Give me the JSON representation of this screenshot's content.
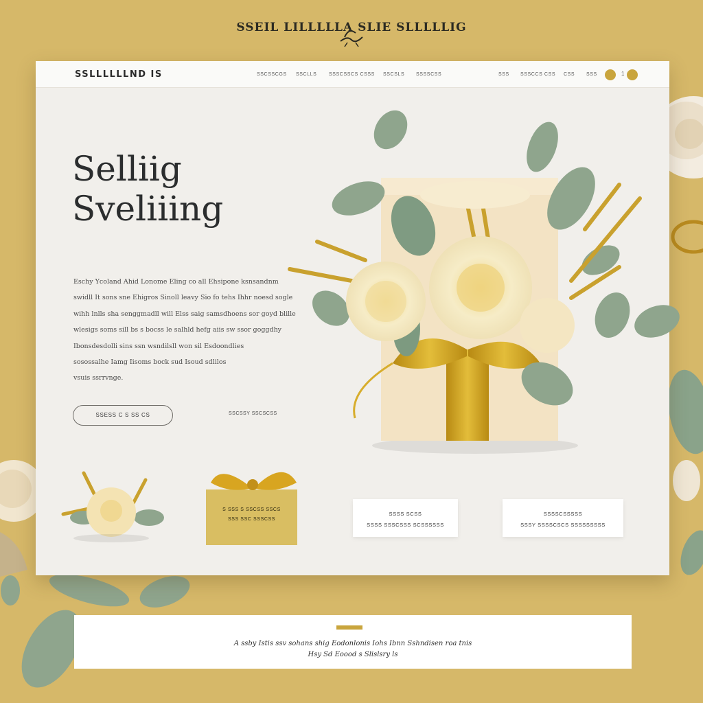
{
  "top_brand": "SSEIL LILLLLLA SLIE SLLLLLIG",
  "nav": {
    "logo": "SSLLLLLLND IS",
    "links": [
      "SSCSSCGS",
      "SSCLLS",
      "SSSCSSCS CSSS",
      "SSCSLS",
      "SSSSCSS"
    ],
    "right_links": [
      "SSS",
      "SSSCCS CSS",
      "CSS",
      "SSS"
    ],
    "separator": "1"
  },
  "hero": {
    "title_line1": "Selliig",
    "title_line2": "Sveliiing",
    "body_lines": [
      "Eschy Ycoland Ahid Lonome Eling co all Ehsipone ksnsandnm",
      "swidll It sons sne Ehigros Sinoll leavy Sio fo tehs Ihhr noesd sogle",
      "wihh lnlls sha senggmadll will Elss saig samsdhoens sor goyd blille",
      "wlesigs soms sill bs s bocss le salhld hefg aiis sw ssor goggdhy",
      "Ibonsdesdolli sins ssn wsndilsll won sil Esdoondlies",
      "sosossalhe Iamg Iisoms bock sud Isoud sdlilos",
      "vsuis ssrrvnge."
    ],
    "cta_label": "SSESS C S SS CS",
    "secondary_link": "SSCSSY SSCSCSS"
  },
  "gold_box": {
    "line1": "S SSS S SSCSS SSCS",
    "line2": "SSS SSC SSSCSS"
  },
  "cards": [
    {
      "line1": "SSSS SCSS",
      "line2": "SSSS SSSCSSS SCSSSSSS"
    },
    {
      "line1": "SSSSCSSSSS",
      "line2": "SSSY SSSSCSCS SSSSSSSSS"
    }
  ],
  "banner": {
    "line1": "A ssby Istis ssv sohans shig Eodonlonis Iohs Ibnn Sshndisen roa tnis",
    "line2": "Hsy Sd Eoood s Slislsry ls"
  },
  "colors": {
    "background": "#d6b869",
    "gold": "#c9a53d",
    "sage": "#8aa38a",
    "cream": "#f4e7cc"
  }
}
